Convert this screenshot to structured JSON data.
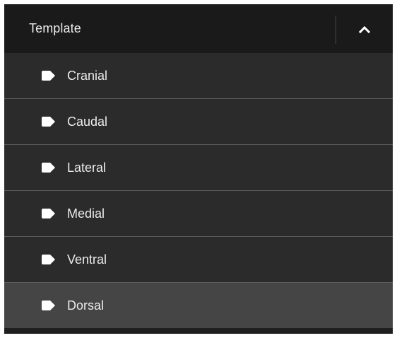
{
  "header": {
    "title": "Template",
    "toggle_icon": "chevron-up-icon"
  },
  "items": [
    {
      "label": "Cranial",
      "icon": "tag-icon",
      "selected": false
    },
    {
      "label": "Caudal",
      "icon": "tag-icon",
      "selected": false
    },
    {
      "label": "Lateral",
      "icon": "tag-icon",
      "selected": false
    },
    {
      "label": "Medial",
      "icon": "tag-icon",
      "selected": false
    },
    {
      "label": "Ventral",
      "icon": "tag-icon",
      "selected": false
    },
    {
      "label": "Dorsal",
      "icon": "tag-icon",
      "selected": true
    }
  ],
  "colors": {
    "panel_bg": "#1f1f1f",
    "header_bg": "#1a1a1a",
    "row_bg": "#2b2b2b",
    "row_selected_bg": "#454545",
    "divider": "#5c5c5c",
    "text": "#ececec"
  }
}
